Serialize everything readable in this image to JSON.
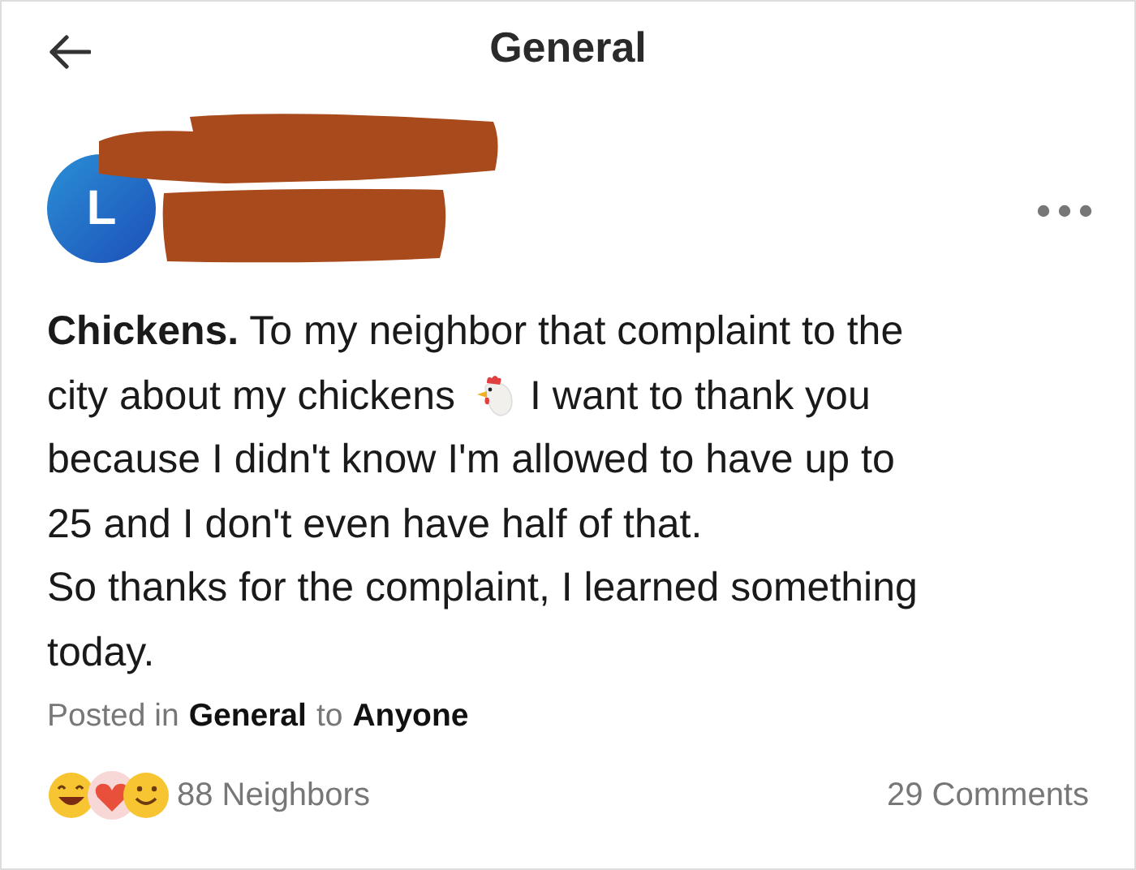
{
  "header": {
    "title": "General"
  },
  "author": {
    "avatar_letter": "L"
  },
  "post": {
    "lines": [
      {
        "kind": "text",
        "text": "**Chickens.** To my neighbor that complaint to the"
      },
      {
        "kind": "icon",
        "before": "city about my chickens",
        "after": "I want to thank you"
      },
      {
        "kind": "text",
        "text": "because I didn't know I'm allowed to have up to"
      },
      {
        "kind": "text",
        "text": "25 and I don't even have half of that."
      },
      {
        "kind": "text",
        "text": "So thanks for the complaint, I learned something"
      },
      {
        "kind": "text",
        "text": "today."
      }
    ]
  },
  "meta": {
    "prefix": "Posted in",
    "group": "General",
    "joiner": "to",
    "audience": "Anyone"
  },
  "footer": {
    "reactions": "88 Neighbors",
    "comments": "29 Comments"
  }
}
